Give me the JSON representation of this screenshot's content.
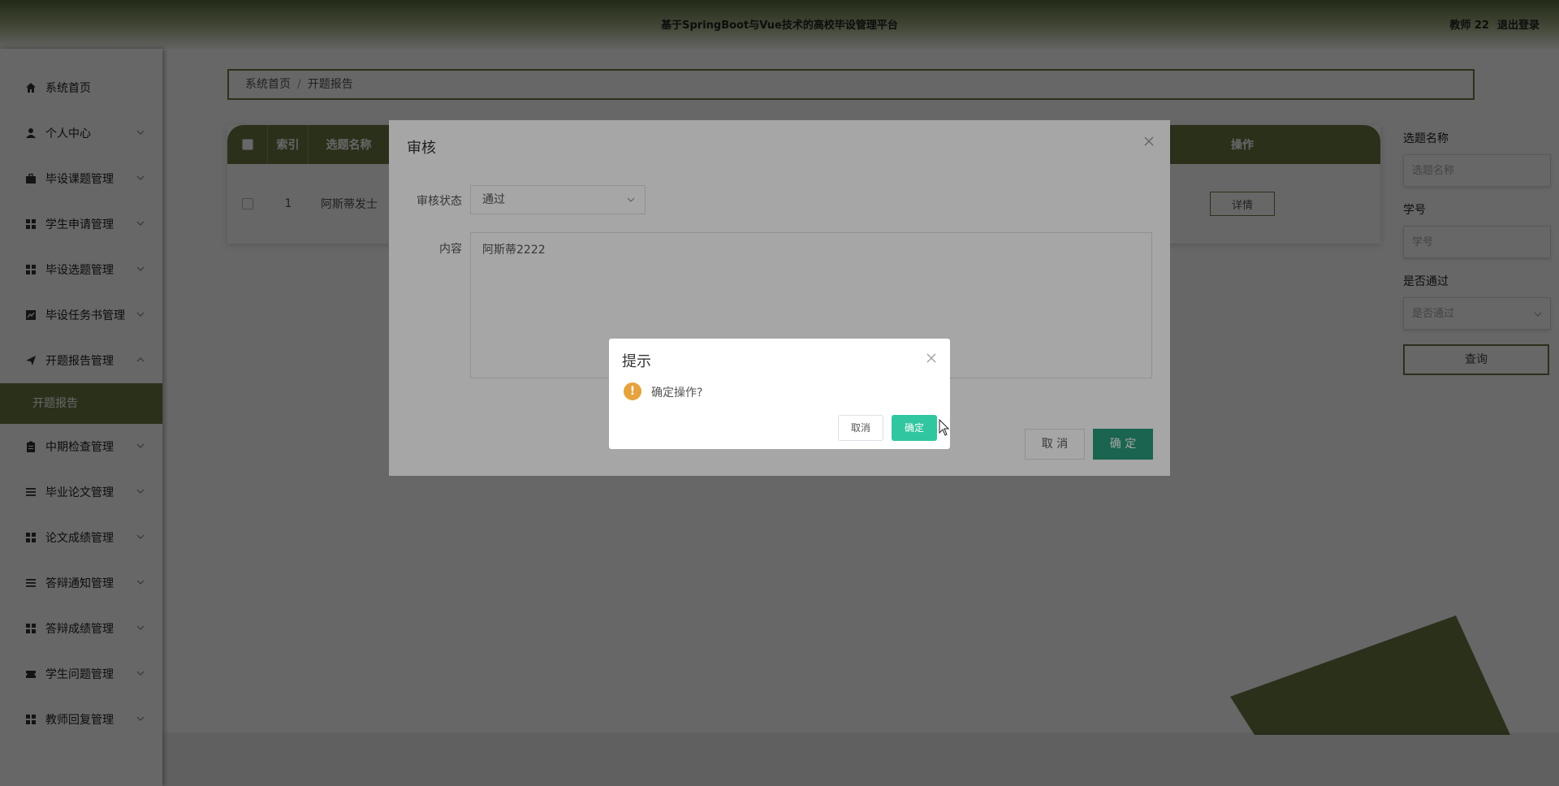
{
  "header": {
    "title": "基于SpringBoot与Vue技术的高校毕设管理平台",
    "user": "教师 22",
    "logout": "退出登录"
  },
  "sidebar": {
    "items": [
      {
        "label": "系统首页",
        "icon": "home-icon"
      },
      {
        "label": "个人中心",
        "icon": "user-icon"
      },
      {
        "label": "毕设课题管理",
        "icon": "briefcase-icon"
      },
      {
        "label": "学生申请管理",
        "icon": "grid-icon"
      },
      {
        "label": "毕设选题管理",
        "icon": "grid-icon"
      },
      {
        "label": "毕设任务书管理",
        "icon": "chart-icon"
      },
      {
        "label": "开题报告管理",
        "icon": "send-icon"
      },
      {
        "label": "中期检查管理",
        "icon": "clipboard-icon"
      },
      {
        "label": "毕业论文管理",
        "icon": "list-icon"
      },
      {
        "label": "论文成绩管理",
        "icon": "grid-icon"
      },
      {
        "label": "答辩通知管理",
        "icon": "list-icon"
      },
      {
        "label": "答辩成绩管理",
        "icon": "grid-icon"
      },
      {
        "label": "学生问题管理",
        "icon": "ticket-icon"
      },
      {
        "label": "教师回复管理",
        "icon": "grid-icon"
      }
    ],
    "active_sub": "开题报告"
  },
  "breadcrumb": {
    "home": "系统首页",
    "current": "开题报告"
  },
  "table": {
    "headers": {
      "index": "索引",
      "topic": "选题名称",
      "action": "操作"
    },
    "rows": [
      {
        "index": "1",
        "topic": "阿斯蒂发士",
        "detail": "详情"
      }
    ]
  },
  "search": {
    "topic_label": "选题名称",
    "topic_placeholder": "选题名称",
    "student_label": "学号",
    "student_placeholder": "学号",
    "pass_label": "是否通过",
    "pass_placeholder": "是否通过",
    "query": "查询"
  },
  "audit_dialog": {
    "title": "审核",
    "status_label": "审核状态",
    "status_value": "通过",
    "content_label": "内容",
    "content_value": "阿斯蒂2222",
    "cancel": "取 消",
    "ok": "确 定"
  },
  "confirm": {
    "title": "提示",
    "message": "确定操作?",
    "cancel": "取消",
    "ok": "确定"
  },
  "colors": {
    "brand": "#6b7a45",
    "ok": "#2a9a7a",
    "confirm_ok": "#30c6a0",
    "warning": "#e6a23c"
  }
}
